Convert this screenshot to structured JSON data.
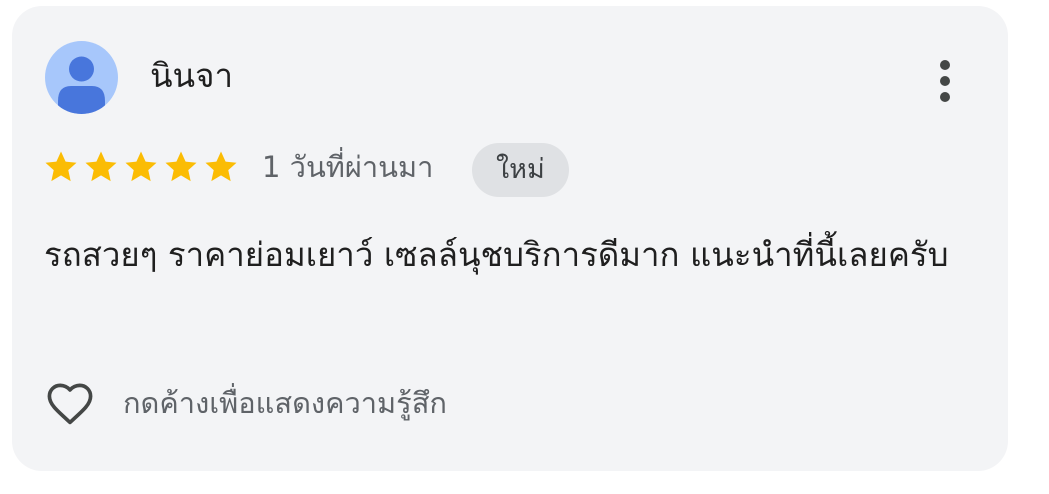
{
  "review": {
    "author_name": "นินจา",
    "rating": 5,
    "rating_max": 5,
    "time_ago": "1 วันที่ผ่านมา",
    "badge_label": "ใหม่",
    "text": "รถสวยๆ ราคาย่อมเยาว์ เซลล์นุชบริการดีมาก แนะนำที่นี้เลยครับ",
    "react_label": "กดค้างเพื่อแสดงความรู้สึก"
  },
  "icons": {
    "avatar": "person-avatar-icon",
    "more": "more-vertical-icon",
    "star": "star-icon",
    "heart": "heart-outline-icon"
  },
  "colors": {
    "card_background": "#f3f4f6",
    "star": "#fbbc04",
    "avatar_background": "#a7c7fb",
    "avatar_figure": "#4876dc",
    "badge_background": "#dfe1e4"
  }
}
